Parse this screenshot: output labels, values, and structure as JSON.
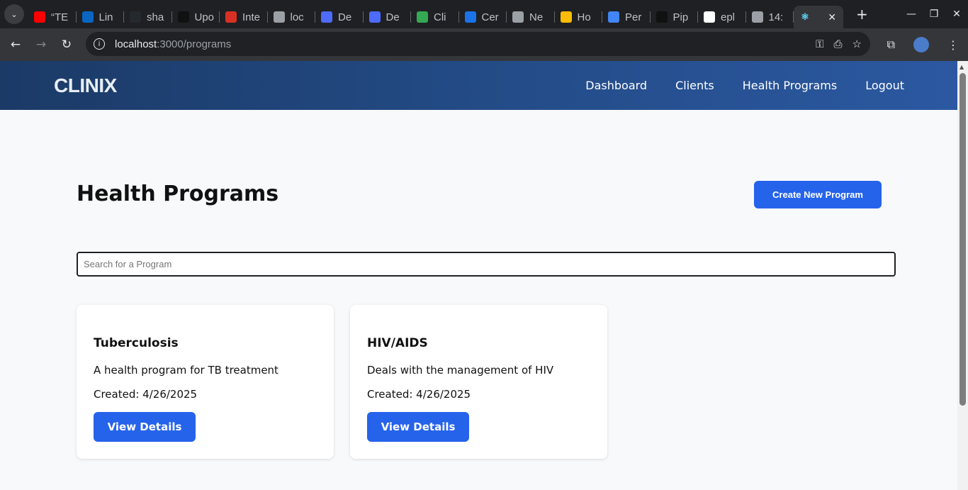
{
  "browser": {
    "tabs": [
      {
        "title": "“TE",
        "icon": "youtube-icon",
        "color": "#ff0000"
      },
      {
        "title": "Lin",
        "icon": "linkedin-icon",
        "color": "#0a66c2"
      },
      {
        "title": "sha",
        "icon": "github-icon",
        "color": "#24292e"
      },
      {
        "title": "Upo",
        "icon": "openai-icon",
        "color": "#111111"
      },
      {
        "title": "Inte",
        "icon": "gauge-icon",
        "color": "#d93025"
      },
      {
        "title": "loc",
        "icon": "globe-icon",
        "color": "#9aa0a6"
      },
      {
        "title": "De",
        "icon": "deepseek-icon",
        "color": "#4d6bfe"
      },
      {
        "title": "De",
        "icon": "deepseek-icon",
        "color": "#4d6bfe"
      },
      {
        "title": "Cli",
        "icon": "clinix-icon",
        "color": "#34a853"
      },
      {
        "title": "Cer",
        "icon": "cert-icon",
        "color": "#1a73e8"
      },
      {
        "title": "Ne",
        "icon": "chrome-icon",
        "color": "#9aa0a6"
      },
      {
        "title": "Ho",
        "icon": "drive-icon",
        "color": "#fbbc04"
      },
      {
        "title": "Per",
        "icon": "docs-icon",
        "color": "#4285f4"
      },
      {
        "title": "Pip",
        "icon": "openai-icon",
        "color": "#111111"
      },
      {
        "title": "epl",
        "icon": "google-icon",
        "color": "#ffffff"
      },
      {
        "title": "14:",
        "icon": "globe-icon",
        "color": "#9aa0a6"
      }
    ],
    "active_tab_icon": "react-icon",
    "url_host": "localhost",
    "url_path": ":3000/programs"
  },
  "header": {
    "logo": "CLINIX",
    "nav": [
      "Dashboard",
      "Clients",
      "Health Programs",
      "Logout"
    ]
  },
  "main": {
    "title": "Health Programs",
    "create_button": "Create New Program",
    "search_placeholder": "Search for a Program",
    "search_value": ""
  },
  "programs": [
    {
      "name": "Tuberculosis",
      "description": "A health program for TB treatment",
      "created": "Created: 4/26/2025",
      "button": "View Details"
    },
    {
      "name": "HIV/AIDS",
      "description": "Deals with the management of HIV",
      "created": "Created: 4/26/2025",
      "button": "View Details"
    }
  ],
  "colors": {
    "primary": "#2563eb",
    "header_start": "#1b3a66",
    "header_end": "#2b58a1",
    "page_bg": "#f8f9fb"
  }
}
